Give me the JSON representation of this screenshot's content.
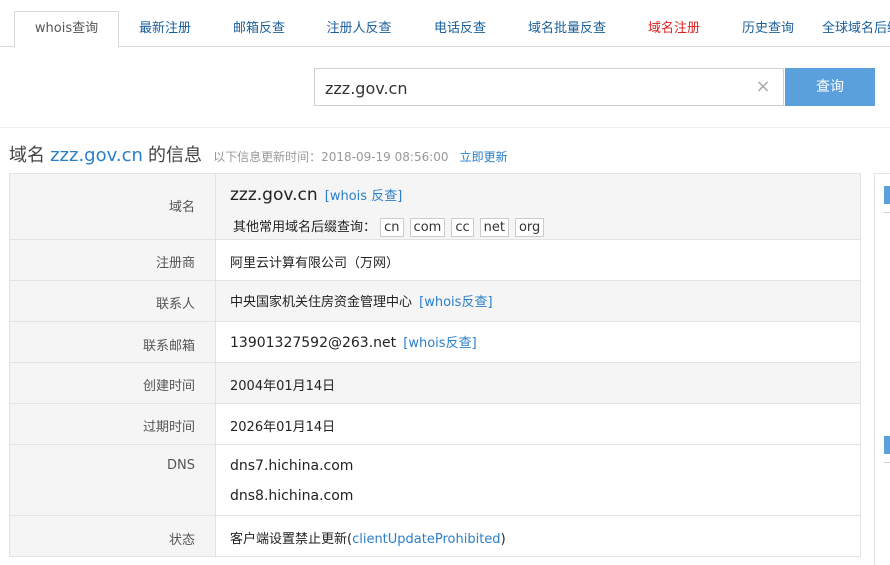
{
  "tabs": [
    {
      "label": "whois查询"
    },
    {
      "label": "最新注册"
    },
    {
      "label": "邮箱反查"
    },
    {
      "label": "注册人反查"
    },
    {
      "label": "电话反查"
    },
    {
      "label": "域名批量反查"
    },
    {
      "label": "域名注册"
    },
    {
      "label": "历史查询"
    },
    {
      "label": "全球域名后缀"
    }
  ],
  "search": {
    "value": "zzz.gov.cn",
    "clear_icon": "×",
    "button_label": "查询"
  },
  "title": {
    "prefix": "域名",
    "domain": "zzz.gov.cn",
    "suffix": "的信息",
    "update_text": "以下信息更新时间：2018-09-19 08:56:00",
    "update_link": "立即更新"
  },
  "rows": {
    "domain": {
      "label": "域名",
      "value": "zzz.gov.cn",
      "reverse": "[whois 反查]",
      "other_label": "其他常用域名后缀查询：",
      "suffixes": [
        "cn",
        "com",
        "cc",
        "net",
        "org"
      ]
    },
    "registrar": {
      "label": "注册商",
      "value": "阿里云计算有限公司（万网）"
    },
    "contact": {
      "label": "联系人",
      "value": "中央国家机关住房资金管理中心",
      "reverse": "[whois反查]"
    },
    "email": {
      "label": "联系邮箱",
      "value": "13901327592@263.net",
      "reverse": "[whois反查]"
    },
    "created": {
      "label": "创建时间",
      "value": "2004年01月14日"
    },
    "expires": {
      "label": "过期时间",
      "value": "2026年01月14日"
    },
    "dns": {
      "label": "DNS",
      "values": [
        "dns7.hichina.com",
        "dns8.hichina.com"
      ]
    },
    "status": {
      "label": "状态",
      "value_pre": "客户端设置禁止更新(",
      "value_code": "clientUpdateProhibited",
      "value_post": ")"
    }
  },
  "colors": {
    "accent": "#2a7fca",
    "button": "#5aa0dd",
    "highlight_tab": "#e02020",
    "label_bg": "#f5f5f5"
  }
}
